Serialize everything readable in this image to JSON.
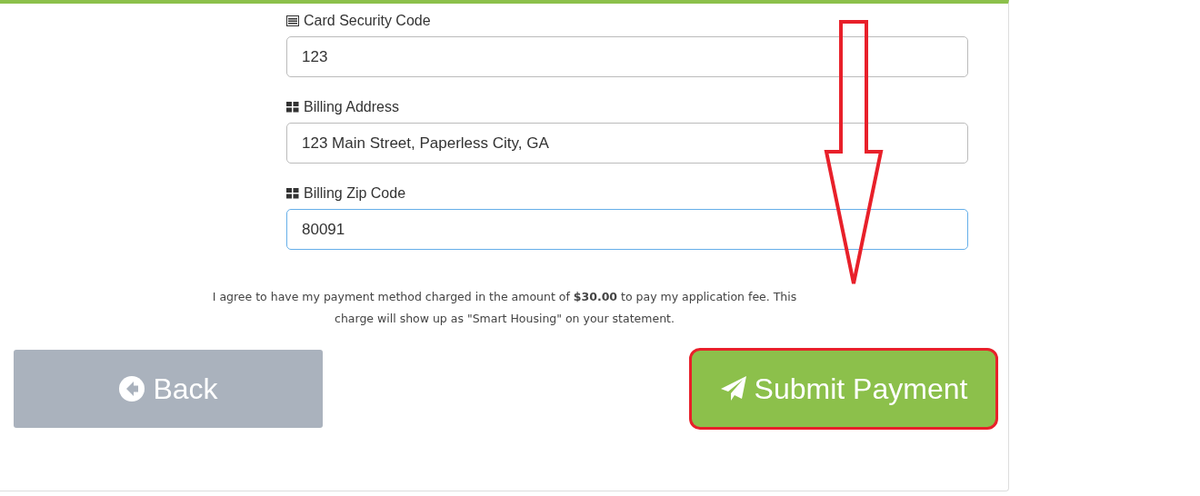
{
  "fields": [
    {
      "kind": "card",
      "label": "Card Security Code",
      "value": "123",
      "focused": false
    },
    {
      "kind": "grid",
      "label": "Billing Address",
      "value": "123 Main Street, Paperless City, GA",
      "focused": false
    },
    {
      "kind": "grid",
      "label": "Billing Zip Code",
      "value": "80091",
      "focused": true
    }
  ],
  "agreement": "I agree to have my payment method charged in the amount of **$30.00** to pay my application fee. This charge will show up as \"Smart Housing\" on your statement.",
  "buttons": [
    {
      "kind": "back",
      "label": "Back",
      "highlighted": false
    },
    {
      "kind": "submit",
      "label": "Submit Payment",
      "highlighted": true
    }
  ]
}
